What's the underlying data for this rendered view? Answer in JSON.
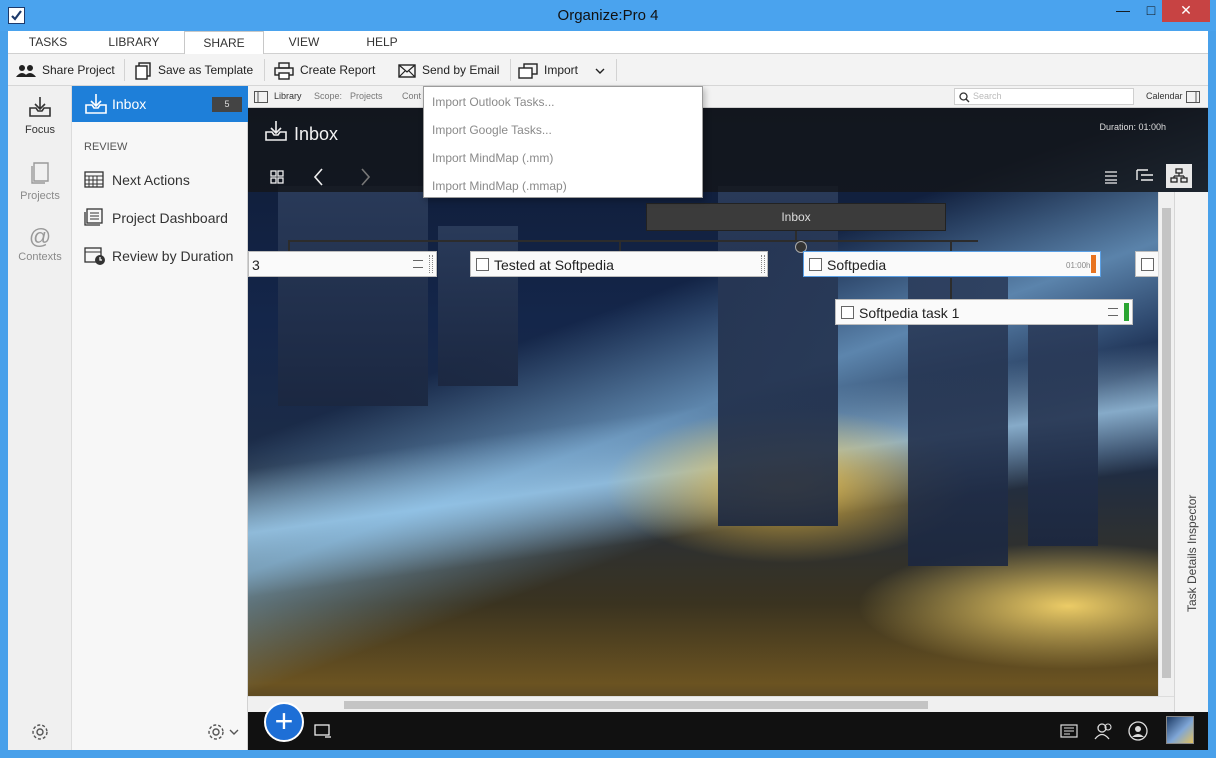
{
  "window": {
    "title": "Organize:Pro 4"
  },
  "ribbon": {
    "tabs": [
      {
        "label": "TASKS"
      },
      {
        "label": "LIBRARY"
      },
      {
        "label": "SHARE",
        "active": true
      },
      {
        "label": "VIEW"
      },
      {
        "label": "HELP"
      }
    ],
    "toolbar": {
      "share_project": "Share Project",
      "save_as_template": "Save as Template",
      "create_report": "Create Report",
      "send_by_email": "Send by Email",
      "import": "Import"
    }
  },
  "import_menu": {
    "items": [
      {
        "label": "Import Outlook Tasks..."
      },
      {
        "label": "Import Google Tasks..."
      },
      {
        "label": "Import MindMap (.mm)"
      },
      {
        "label": "Import MindMap (.mmap)"
      }
    ]
  },
  "rail": {
    "items": [
      {
        "label": "Focus",
        "icon": "focus-icon",
        "active": true
      },
      {
        "label": "Projects",
        "icon": "projects-icon"
      },
      {
        "label": "Contexts",
        "icon": "contexts-icon"
      }
    ]
  },
  "sidebar": {
    "inbox": {
      "label": "Inbox",
      "count": "5"
    },
    "review_header": "REVIEW",
    "items": [
      {
        "label": "Next Actions",
        "icon": "calendar-grid-icon"
      },
      {
        "label": "Project Dashboard",
        "icon": "dashboard-icon"
      },
      {
        "label": "Review by Duration",
        "icon": "clock-calendar-icon"
      }
    ]
  },
  "viewbar": {
    "library": "Library",
    "scope_label": "Scope:",
    "scope_value": "Projects",
    "context_value": "Cont",
    "search_placeholder": "Search",
    "calendar": "Calendar"
  },
  "header": {
    "title": "Inbox",
    "duration": "Duration: 01:00h"
  },
  "map": {
    "root": "Inbox",
    "nodes": [
      {
        "label": "3"
      },
      {
        "label": "Tested at Softpedia"
      },
      {
        "label": "Softpedia",
        "duration": "01:00h",
        "priority_color": "#e8731f"
      },
      {
        "label": "Softpedia task 1",
        "priority_color": "#2aa532"
      }
    ]
  },
  "inspector": {
    "label": "Task Details Inspector"
  },
  "colors": {
    "accent": "#1e7fd9",
    "close": "#c74343"
  }
}
